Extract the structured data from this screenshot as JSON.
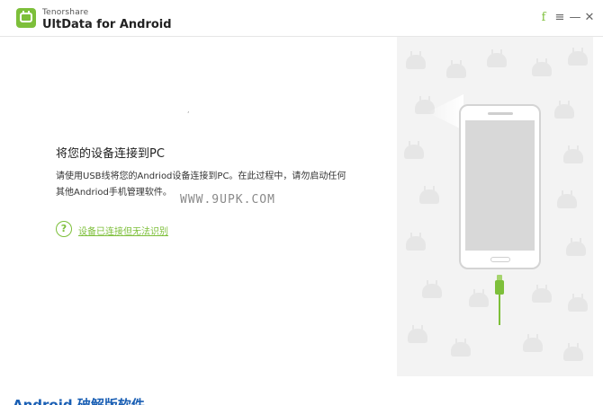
{
  "titlebar": {
    "brand": "Tenorshare",
    "product": "UltData for Android",
    "controls": {
      "facebook": "f",
      "menu": "≡",
      "minimize": "—",
      "close": "✕"
    }
  },
  "main": {
    "tick": ",",
    "heading": "将您的设备连接到PC",
    "description": "请使用USB线将您的Andriod设备连接到PC。在此过程中，请勿启动任何其他Andriod手机管理软件。",
    "watermark": "WWW.9UPK.COM",
    "help_icon": "?",
    "help_link": "设备已连接但无法识别"
  },
  "footer": {
    "text": "Android 破解版软件"
  },
  "colors": {
    "accent": "#7dbf3a",
    "panel_bg": "#f3f3f3",
    "footer_text": "#1a5fb4"
  }
}
